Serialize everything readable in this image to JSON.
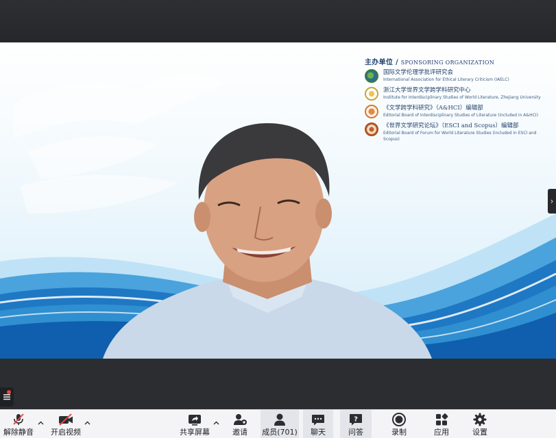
{
  "slide": {
    "sponsor_heading_cn": "主办单位",
    "sponsor_heading_sep": " / ",
    "sponsor_heading_en": "SPONSORING ORGANIZATION",
    "organizations": [
      {
        "cn": "国际文学伦理学批评研究会",
        "en": "International Association for Ethical Literary Criticism (IAELC)"
      },
      {
        "cn": "浙江大学世界文学跨学科研究中心",
        "en": "Institute for Interdisciplinary Studies of World Literature, Zhejiang University"
      },
      {
        "cn": "《文学跨学科研究》（A&HCI）编辑部",
        "en": "Editorial Board of Interdisciplinary Studies of Literature (included in A&HCI)"
      },
      {
        "cn": "《世界文学研究论坛》（ESCI and Scopus）编辑部",
        "en": "Editorial Board of Forum for World Literature Studies (included in ESCI and Scopus)"
      }
    ]
  },
  "toolbar": {
    "unmute": "解除静音",
    "start_video": "开启视频",
    "share_screen": "共享屏幕",
    "invite": "邀请",
    "members": "成员(701)",
    "chat": "聊天",
    "qa": "问答",
    "record": "录制",
    "apps": "应用",
    "settings": "设置"
  },
  "colors": {
    "toolbar_bg": "#f4f4f6",
    "window_bg": "#2b2d31",
    "muted_red": "#e5483d",
    "wave_blue": "#2f8fd0"
  },
  "icons": {
    "unmute": "mic-muted-icon",
    "video": "video-off-icon",
    "share": "share-screen-icon",
    "invite": "add-person-icon",
    "members": "members-icon",
    "chat": "chat-icon",
    "qa": "qa-icon",
    "record": "record-icon",
    "apps": "apps-icon",
    "settings": "gear-icon"
  }
}
